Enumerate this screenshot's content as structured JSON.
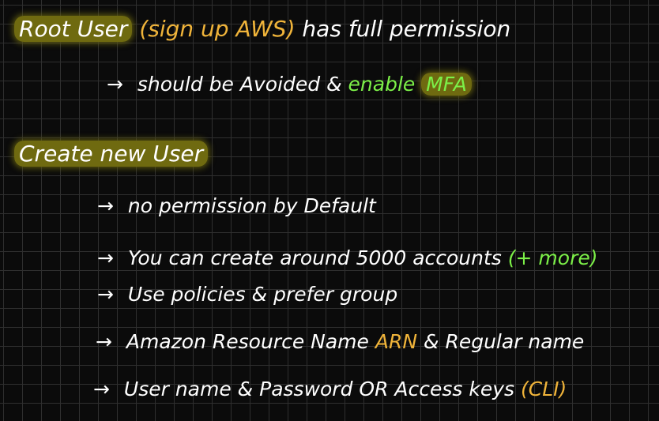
{
  "line1": {
    "root_user": "Root User",
    "signup": "(sign up AWS)",
    "rest": "has full permission"
  },
  "line2": {
    "arrow": "→",
    "text": "should be Avoided &",
    "enable": "enable",
    "mfa": "MFA"
  },
  "line3": {
    "title": "Create new User"
  },
  "bullets": {
    "b1": {
      "arrow": "→",
      "text": "no permission by Default"
    },
    "b2": {
      "arrow": "→",
      "text": "You can create around 5000 accounts",
      "extra": "(+ more)"
    },
    "b3": {
      "arrow": "→",
      "text": "Use policies & prefer group"
    },
    "b4": {
      "arrow": "→",
      "text": "Amazon Resource Name",
      "arn": "ARN",
      "rest": "& Regular name"
    },
    "b5": {
      "arrow": "→",
      "text": "User name & Password OR Access keys",
      "cli": "(CLI)"
    }
  },
  "colors": {
    "highlight": "#6f6a10",
    "accent_yellow": "#f0b43a",
    "accent_green": "#7cf048"
  }
}
